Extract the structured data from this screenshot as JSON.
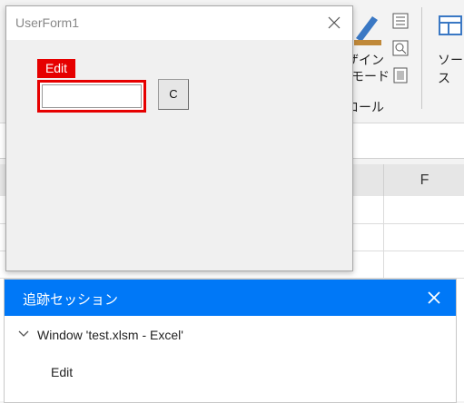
{
  "excel": {
    "ribbon_text": {
      "design_line1": "ザイン",
      "design_line2": "モード",
      "control": "ロール",
      "source": "ソース"
    },
    "column_header_visible": "F"
  },
  "userform": {
    "title": "UserForm1",
    "edit_label": "Edit",
    "edit_value": "",
    "button_label": "C"
  },
  "trace_panel": {
    "title": "追跡セッション",
    "tree": {
      "root": "Window 'test.xlsm - Excel'",
      "child": "Edit"
    }
  },
  "colors": {
    "highlight_red": "#e60000",
    "panel_blue": "#0078f7"
  }
}
